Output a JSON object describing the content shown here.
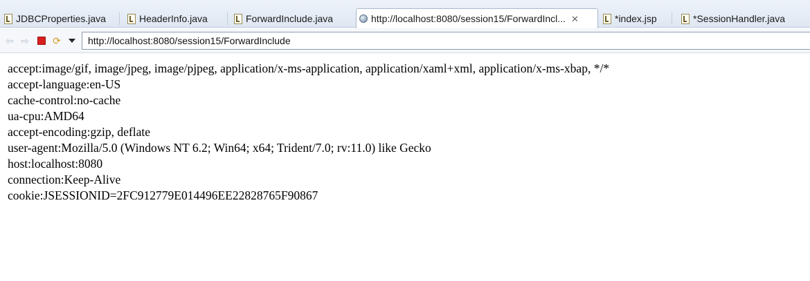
{
  "tabs": [
    {
      "label": "JDBCProperties.java",
      "icon": "java-file-icon",
      "active": false
    },
    {
      "label": "HeaderInfo.java",
      "icon": "java-file-icon",
      "active": false
    },
    {
      "label": "ForwardInclude.java",
      "icon": "java-file-icon",
      "active": false
    },
    {
      "label": "http://localhost:8080/session15/ForwardIncl...",
      "icon": "globe-icon",
      "active": true
    },
    {
      "label": "*index.jsp",
      "icon": "jsp-file-icon",
      "active": false
    },
    {
      "label": "*SessionHandler.java",
      "icon": "java-file-icon",
      "active": false
    }
  ],
  "toolbar": {
    "url": "http://localhost:8080/session15/ForwardInclude",
    "buttons": [
      "back-icon",
      "forward-icon",
      "stop-icon",
      "refresh-icon",
      "dropdown-icon"
    ]
  },
  "headers": [
    "accept:image/gif, image/jpeg, image/pjpeg, application/x-ms-application, application/xaml+xml, application/x-ms-xbap, */*",
    "accept-language:en-US",
    "cache-control:no-cache",
    "ua-cpu:AMD64",
    "accept-encoding:gzip, deflate",
    "user-agent:Mozilla/5.0 (Windows NT 6.2; Win64; x64; Trident/7.0; rv:11.0) like Gecko",
    "host:localhost:8080",
    "connection:Keep-Alive",
    "cookie:JSESSIONID=2FC912779E014496EE22828765F90867"
  ],
  "colors": {
    "stop": "#d81f1f",
    "tab_bar": "#dfe7f2"
  }
}
